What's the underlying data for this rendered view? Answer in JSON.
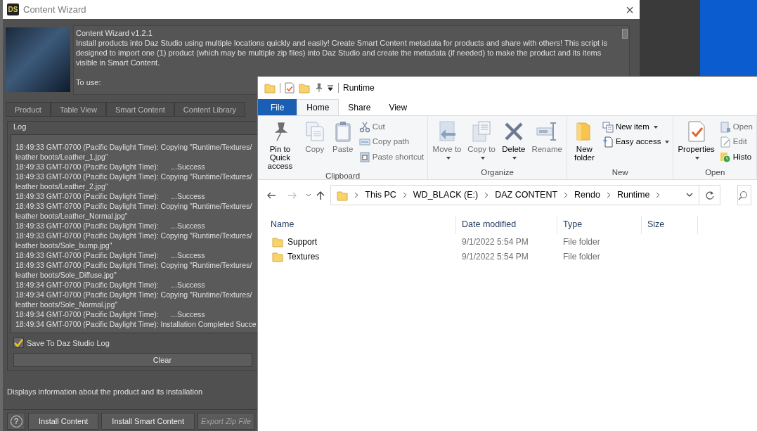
{
  "content_wizard": {
    "title": "Content Wizard",
    "logo": "DS",
    "close": "×",
    "heading": "Content Wizard v1.2.1",
    "description": "Install products into Daz Studio using multiple locations quickly and easily!  Create Smart Content metadata for products and share with others!  This script is designed to import one (1) product (which may be multiple zip files) into Daz Studio and create the metadata (if needed) to make the product and its items visible in Smart Content.",
    "to_use": "To use:",
    "tabs": [
      {
        "label": "Product",
        "selected": false
      },
      {
        "label": "Table View",
        "selected": false
      },
      {
        "label": "Smart Content",
        "selected": false
      },
      {
        "label": "Content Library",
        "selected": false
      }
    ],
    "log": {
      "title": "Log",
      "lines": [
        "18:49:33 GMT-0700 (Pacific Daylight Time): Copying \"Runtime/Textures/",
        "leather boots/Leather_1.jpg\"",
        "18:49:33 GMT-0700 (Pacific Daylight Time):      ...Success",
        "18:49:33 GMT-0700 (Pacific Daylight Time): Copying \"Runtime/Textures/",
        "leather boots/Leather_2.jpg\"",
        "18:49:33 GMT-0700 (Pacific Daylight Time):      ...Success",
        "18:49:33 GMT-0700 (Pacific Daylight Time): Copying \"Runtime/Textures/",
        "leather boots/Leather_Normal.jpg\"",
        "18:49:33 GMT-0700 (Pacific Daylight Time):      ...Success",
        "18:49:33 GMT-0700 (Pacific Daylight Time): Copying \"Runtime/Textures/",
        "leather boots/Sole_bump.jpg\"",
        "18:49:33 GMT-0700 (Pacific Daylight Time):      ...Success",
        "18:49:33 GMT-0700 (Pacific Daylight Time): Copying \"Runtime/Textures/",
        "leather boots/Sole_Diffuse.jpg\"",
        "18:49:34 GMT-0700 (Pacific Daylight Time):      ...Success",
        "18:49:34 GMT-0700 (Pacific Daylight Time): Copying \"Runtime/Textures/",
        "leather boots/Sole_Normal.jpg\"",
        "18:49:34 GMT-0700 (Pacific Daylight Time):      ...Success",
        "18:49:34 GMT-0700 (Pacific Daylight Time): Installation Completed Succe"
      ]
    },
    "save_to_log": {
      "label": "Save To Daz Studio Log",
      "checked": true
    },
    "clear_button": "Clear",
    "info": "Displays information about the product and its installation",
    "help_button": "?",
    "buttons": [
      {
        "label": "Install Content",
        "disabled": false
      },
      {
        "label": "Install Smart Content",
        "disabled": false
      },
      {
        "label": "Export Zip File",
        "disabled": true
      }
    ]
  },
  "explorer": {
    "title": "Runtime",
    "ribbon_tabs": [
      {
        "label": "File",
        "kind": "file",
        "selected": false
      },
      {
        "label": "Home",
        "kind": "tab",
        "selected": true
      },
      {
        "label": "Share",
        "kind": "tab",
        "selected": false
      },
      {
        "label": "View",
        "kind": "tab",
        "selected": false
      }
    ],
    "groups": [
      {
        "name": "Clipboard",
        "items": [
          {
            "label": "Pin to Quick access",
            "kind": "large",
            "disabled": false,
            "dropdown": false
          },
          {
            "label": "Copy",
            "kind": "large",
            "disabled": true,
            "dropdown": false
          },
          {
            "label": "Paste",
            "kind": "large",
            "disabled": true,
            "dropdown": false
          },
          {
            "label": "Cut",
            "kind": "small",
            "disabled": true,
            "dropdown": false
          },
          {
            "label": "Copy path",
            "kind": "small",
            "disabled": true,
            "dropdown": false
          },
          {
            "label": "Paste shortcut",
            "kind": "small",
            "disabled": true,
            "dropdown": false
          }
        ]
      },
      {
        "name": "Organize",
        "items": [
          {
            "label": "Move to",
            "kind": "large",
            "disabled": true,
            "dropdown": true
          },
          {
            "label": "Copy to",
            "kind": "large",
            "disabled": true,
            "dropdown": true
          },
          {
            "label": "Delete",
            "kind": "large",
            "disabled": false,
            "dropdown": true
          },
          {
            "label": "Rename",
            "kind": "large",
            "disabled": true,
            "dropdown": false
          }
        ]
      },
      {
        "name": "New",
        "items": [
          {
            "label": "New folder",
            "kind": "large",
            "disabled": false,
            "dropdown": false
          },
          {
            "label": "New item",
            "kind": "small",
            "disabled": false,
            "dropdown": true
          },
          {
            "label": "Easy access",
            "kind": "small",
            "disabled": false,
            "dropdown": true
          }
        ]
      },
      {
        "name": "Open",
        "items": [
          {
            "label": "Properties",
            "kind": "large",
            "disabled": false,
            "dropdown": true
          },
          {
            "label": "Open",
            "kind": "small",
            "disabled": true,
            "dropdown": false
          },
          {
            "label": "Edit",
            "kind": "small",
            "disabled": true,
            "dropdown": false
          },
          {
            "label": "Histo",
            "kind": "small",
            "disabled": false,
            "dropdown": false
          }
        ]
      }
    ],
    "nav": {
      "back_disabled": false,
      "forward_disabled": true
    },
    "path": [
      "This PC",
      "WD_BLACK (E:)",
      "DAZ CONTENT",
      "Rendo",
      "Runtime"
    ],
    "columns": [
      "Name",
      "Date modified",
      "Type",
      "Size"
    ],
    "rows": [
      {
        "name": "Support",
        "date": "9/1/2022 5:54 PM",
        "type": "File folder"
      },
      {
        "name": "Textures",
        "date": "9/1/2022 5:54 PM",
        "type": "File folder"
      }
    ]
  }
}
